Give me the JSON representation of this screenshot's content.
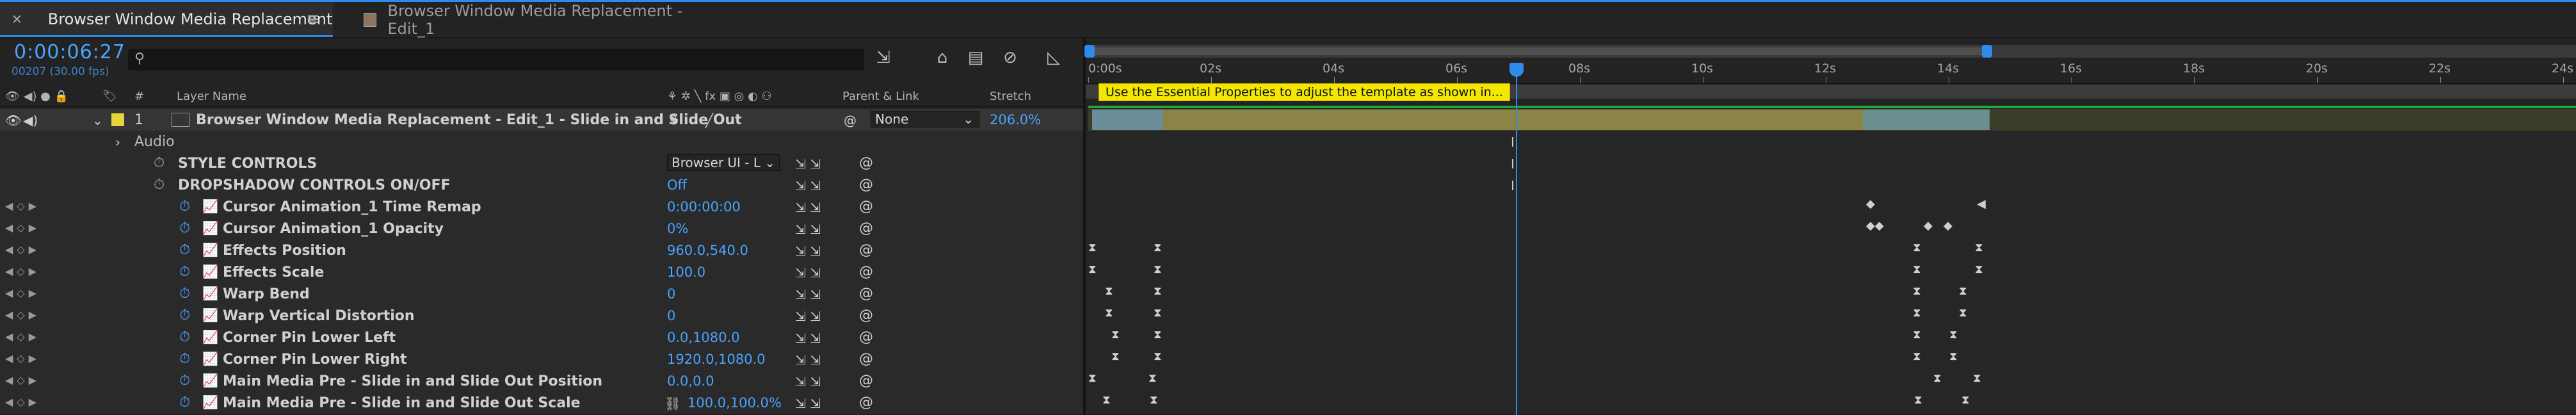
{
  "tabs": [
    {
      "label": "Browser Window Media Replacement",
      "active": true
    },
    {
      "label": "Browser Window Media Replacement - Edit_1",
      "active": false
    }
  ],
  "timecode": "0:00:06:27",
  "frame_info": "00207 (30.00 fps)",
  "search_placeholder": "",
  "columns": {
    "hash": "#",
    "layer_name": "Layer Name",
    "parent_link": "Parent & Link",
    "stretch": "Stretch"
  },
  "layer": {
    "index": "1",
    "name": "Browser Window Media Replacement - Edit_1 - Slide in and Slide Out",
    "parent": "None",
    "stretch": "206.0%",
    "label_color": "#e8d43a"
  },
  "rows": [
    {
      "name": "Audio",
      "value": ""
    },
    {
      "name": "STYLE CONTROLS",
      "value": "Browser UI - L"
    },
    {
      "name": "DROPSHADOW CONTROLS ON/OFF",
      "value": "Off"
    },
    {
      "name": "Cursor Animation_1 Time Remap",
      "value": "0:00:00:00"
    },
    {
      "name": "Cursor Animation_1 Opacity",
      "value": "0%"
    },
    {
      "name": "Effects Position",
      "value": "960.0,540.0"
    },
    {
      "name": "Effects Scale",
      "value": "100.0"
    },
    {
      "name": "Warp Bend",
      "value": "0"
    },
    {
      "name": "Warp Vertical Distortion",
      "value": "0"
    },
    {
      "name": "Corner Pin Lower Left",
      "value": "0.0,1080.0"
    },
    {
      "name": "Corner Pin Lower Right",
      "value": "1920.0,1080.0"
    },
    {
      "name": "Main Media Pre - Slide in and Slide Out Position",
      "value": "0.0,0.0"
    },
    {
      "name": "Main Media Pre - Slide in and Slide Out Scale",
      "value": "100.0,100.0%"
    }
  ],
  "ruler_labels": [
    "0:00s",
    "02s",
    "04s",
    "06s",
    "08s",
    "10s",
    "12s",
    "14s",
    "16s",
    "18s",
    "20s",
    "22s",
    "24s"
  ],
  "marker_comment": "Use the Essential Properties to adjust the template as shown in...",
  "colors": {
    "accent": "#2d8ceb",
    "timecode": "#4aa3ff",
    "label_yellow": "#e8d43a",
    "marker": "#f3e600"
  }
}
